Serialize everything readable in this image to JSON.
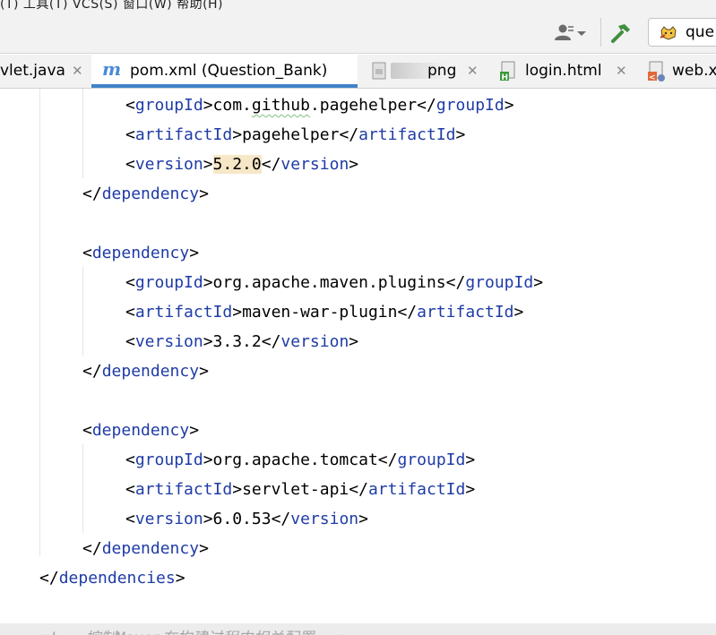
{
  "menu": {
    "text": "(T)  工具(T)  VCS(S)  窗口(W)  帮助(H)"
  },
  "toolbar": {
    "run_config_label": "que",
    "user_icon": "user-dropdown-icon",
    "build_icon": "hammer-icon",
    "run_icon": "tomcat-icon"
  },
  "tabs": [
    {
      "label": "vlet.java",
      "icon": "java-file-icon",
      "closable": true,
      "active": false
    },
    {
      "label": "pom.xml (Question_Bank)",
      "icon": "maven-icon",
      "closable": false,
      "active": true
    },
    {
      "label": "png",
      "icon": "image-file-icon",
      "closable": true,
      "active": false
    },
    {
      "label": "login.html",
      "icon": "html-file-icon",
      "closable": true,
      "active": false
    },
    {
      "label": "web.x",
      "icon": "xml-file-icon",
      "closable": false,
      "active": false
    }
  ],
  "code": {
    "l1": {
      "open": "groupId",
      "text": "com.github.pagehelper",
      "close": "groupId"
    },
    "l2": {
      "open": "artifactId",
      "text": "pagehelper",
      "close": "artifactId"
    },
    "l3": {
      "open": "version",
      "text": "5.2.0",
      "close": "version"
    },
    "l4": {
      "close": "dependency"
    },
    "l6": {
      "open": "dependency"
    },
    "l7": {
      "open": "groupId",
      "text": "org.apache.maven.plugins",
      "close": "groupId"
    },
    "l8": {
      "open": "artifactId",
      "text": "maven-war-plugin",
      "close": "artifactId"
    },
    "l9": {
      "open": "version",
      "text": "3.3.2",
      "close": "version"
    },
    "l10": {
      "close": "dependency"
    },
    "l12": {
      "open": "dependency"
    },
    "l13": {
      "open": "groupId",
      "text": "org.apache.tomcat",
      "close": "groupId"
    },
    "l14": {
      "open": "artifactId",
      "text": "servlet-api",
      "close": "artifactId"
    },
    "l15": {
      "open": "version",
      "text": "6.0.53",
      "close": "version"
    },
    "l16": {
      "close": "dependency"
    },
    "l17": {
      "close": "dependencies"
    }
  },
  "bottom_comment": "<!-- 控制Maven在构建过程中相关配置 -->",
  "colors": {
    "tag": "#1f3ca6",
    "tab_underline": "#4083c9",
    "highlight": "#f6e7c7"
  }
}
